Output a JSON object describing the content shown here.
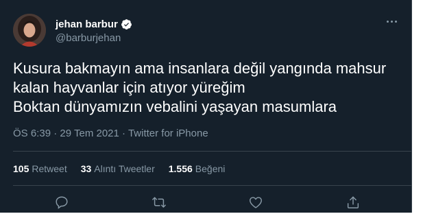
{
  "author": {
    "display_name": "jehan barbur",
    "handle": "@barburjehan",
    "verified": true
  },
  "tweet": {
    "lines": [
      "Kusura bakmayın ama insanlara değil yangında mahsur",
      "kalan hayvanlar için atıyor yüreğim",
      "Boktan dünyamızın vebalini yaşayan masumlara"
    ],
    "time": "ÖS 6:39",
    "separator": "·",
    "date": "29 Tem 2021",
    "source": "Twitter for iPhone"
  },
  "stats": {
    "retweets": {
      "count": "105",
      "label": "Retweet"
    },
    "quotes": {
      "count": "33",
      "label": "Alıntı Tweetler"
    },
    "likes": {
      "count": "1.556",
      "label": "Beğeni"
    }
  },
  "actions": [
    "reply-icon",
    "retweet-icon",
    "like-icon",
    "share-icon"
  ],
  "colors": {
    "background": "#15202b",
    "text": "#ffffff",
    "secondary": "#8899a6",
    "divider": "#38444d",
    "verified": "#ffffff"
  }
}
